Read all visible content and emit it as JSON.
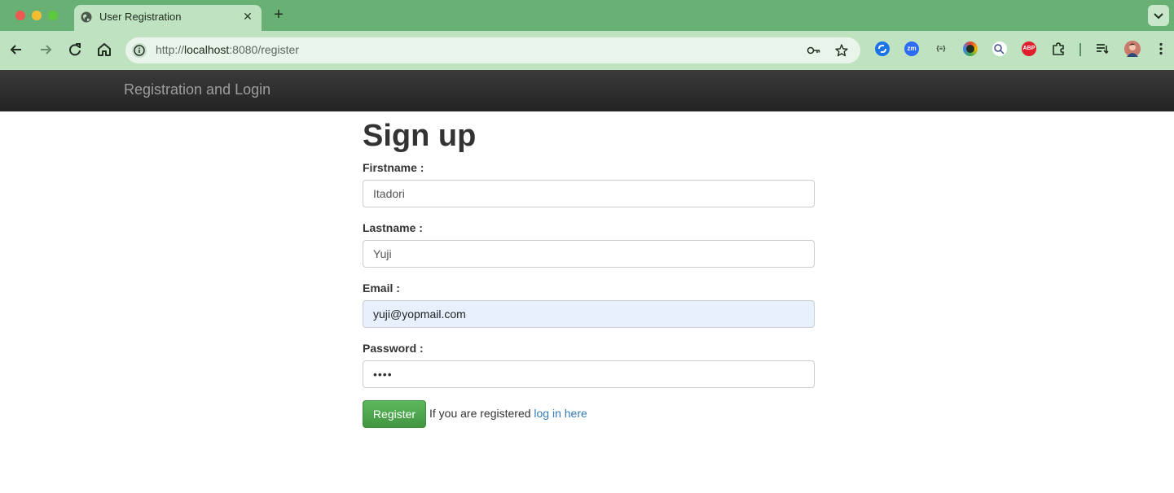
{
  "browser": {
    "tab_title": "User Registration",
    "new_tab_symbol": "+",
    "url_prefix": "http://",
    "url_host": "localhost",
    "url_rest": ":8080/register",
    "extensions": [
      {
        "name": "sync-extension-icon",
        "label": "",
        "color": "#1a73e8"
      },
      {
        "name": "zoom-extension-icon",
        "label": "zm",
        "color": "#2d6cf6"
      },
      {
        "name": "json-extension-icon",
        "label": "{≡}",
        "color": "#bfe2c1"
      },
      {
        "name": "color-extension-icon",
        "label": "",
        "color": "#3c4043"
      },
      {
        "name": "translate-extension-icon",
        "label": "",
        "color": "#ffffff"
      },
      {
        "name": "adblock-extension-icon",
        "label": "ABP",
        "color": "#e0202f"
      }
    ]
  },
  "navbar": {
    "brand": "Registration and Login"
  },
  "form": {
    "heading": "Sign up",
    "firstname_label": "Firstname :",
    "firstname_value": "Itadori",
    "lastname_label": "Lastname :",
    "lastname_value": "Yuji",
    "email_label": "Email :",
    "email_value": "yuji@yopmail.com",
    "password_label": "Password :",
    "password_value": "••••",
    "register_label": "Register",
    "login_prompt": "If you are registered",
    "login_link": "log in here"
  },
  "colors": {
    "chrome_tabbar": "#68b073",
    "chrome_toolbar": "#bfe2c1",
    "navbar": "#222222",
    "register_button": "#419641",
    "link": "#337ab7"
  }
}
